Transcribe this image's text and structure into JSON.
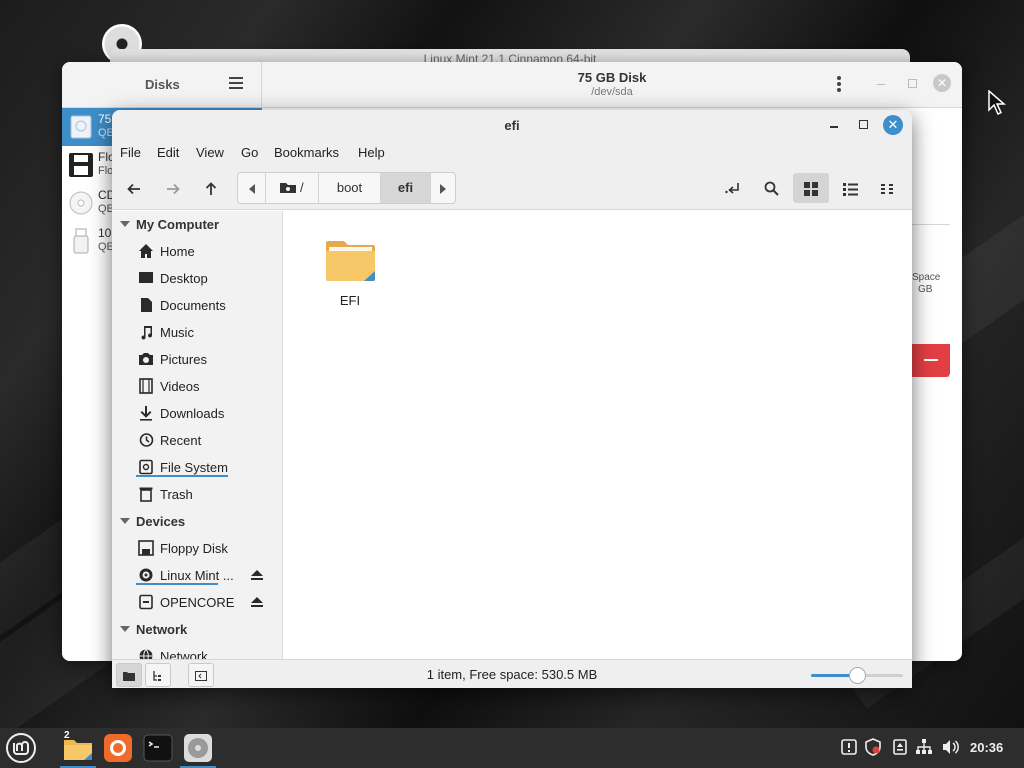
{
  "background_window": {
    "title": "Linux Mint 21.1 Cinnamon 64-bit"
  },
  "disks_window": {
    "sidebar_title": "Disks",
    "disk_title": "75 GB Disk",
    "disk_path": "/dev/sda",
    "drives": [
      {
        "name": "75",
        "sub": "QE",
        "icon": "hard-disk-icon",
        "selected": true
      },
      {
        "name": "Flo",
        "sub": "Flo",
        "icon": "floppy-icon"
      },
      {
        "name": "CD",
        "sub": "QE",
        "icon": "cdrom-icon"
      },
      {
        "name": "10",
        "sub": "QE",
        "icon": "usb-drive-icon"
      }
    ],
    "free_space_label": "Space",
    "free_space_size": "GB",
    "accent_delete": "#e23f44"
  },
  "file_manager": {
    "title": "efi",
    "menu": [
      "File",
      "Edit",
      "View",
      "Go",
      "Bookmarks",
      "Help"
    ],
    "breadcrumb": {
      "root": "/",
      "items": [
        "boot",
        "efi"
      ],
      "active": "efi"
    },
    "sidebar": {
      "my_computer": {
        "heading": "My Computer",
        "items": [
          {
            "label": "Home",
            "icon": "home-icon"
          },
          {
            "label": "Desktop",
            "icon": "desktop-icon"
          },
          {
            "label": "Documents",
            "icon": "documents-icon"
          },
          {
            "label": "Music",
            "icon": "music-icon"
          },
          {
            "label": "Pictures",
            "icon": "pictures-icon"
          },
          {
            "label": "Videos",
            "icon": "videos-icon"
          },
          {
            "label": "Downloads",
            "icon": "downloads-icon"
          },
          {
            "label": "Recent",
            "icon": "recent-icon"
          },
          {
            "label": "File System",
            "icon": "filesystem-icon"
          },
          {
            "label": "Trash",
            "icon": "trash-icon"
          }
        ]
      },
      "devices": {
        "heading": "Devices",
        "items": [
          {
            "label": "Floppy Disk",
            "icon": "floppy-icon"
          },
          {
            "label": "Linux Mint ...",
            "icon": "disc-icon",
            "eject": true
          },
          {
            "label": "OPENCORE",
            "icon": "drive-icon",
            "eject": true
          }
        ]
      },
      "network": {
        "heading": "Network",
        "items": [
          {
            "label": "Network",
            "icon": "network-icon"
          }
        ]
      }
    },
    "files": [
      {
        "name": "EFI",
        "type": "folder"
      }
    ],
    "status": "1 item, Free space: 530.5 MB",
    "zoom_level": 0.5,
    "accent": "#3d8ec9"
  },
  "taskbar": {
    "workspace_badge": "2",
    "clock": "20:36",
    "apps": [
      "menu-icon",
      "files-icon",
      "firefox-icon",
      "terminal-icon",
      "disks-icon"
    ]
  }
}
